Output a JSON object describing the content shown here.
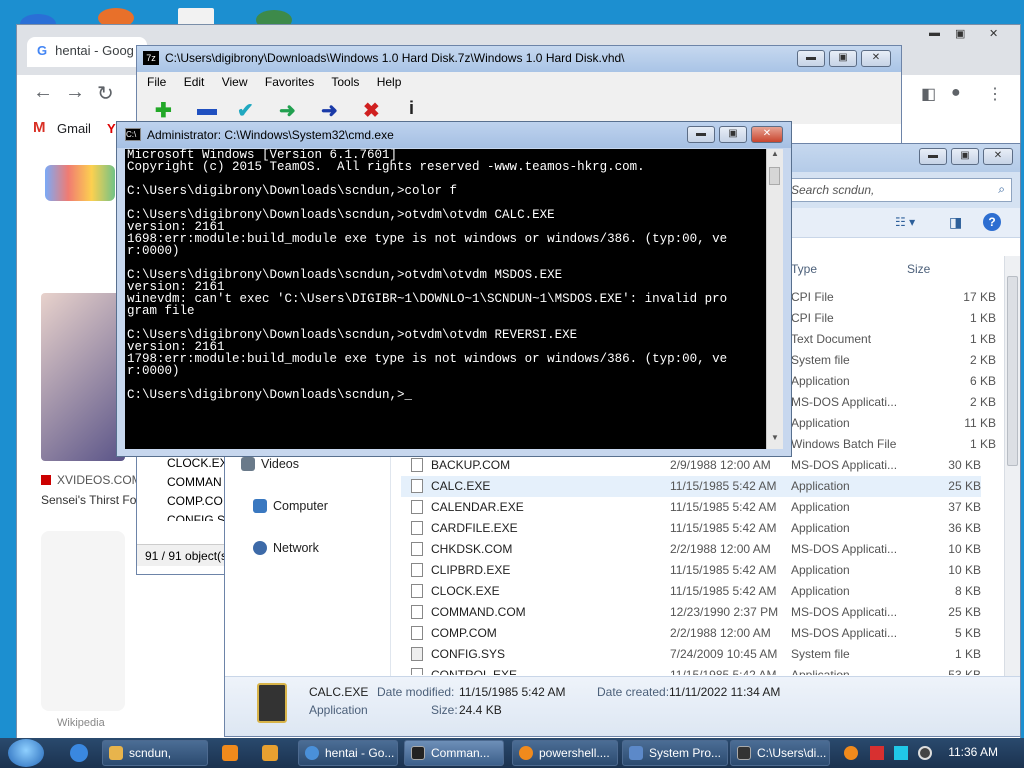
{
  "chrome": {
    "tab_title": "hentai - Goog",
    "bookmark_gmail": "Gmail",
    "bookmark_y": "Y",
    "sidebar_site": "XVIDEOS.COM",
    "sidebar_caption": "Sensei's Thirst Fo",
    "bottom_text": "Wikipedia"
  },
  "sevenzip": {
    "title": "C:\\Users\\digibrony\\Downloads\\Windows 1.0 Hard Disk.7z\\Windows 1.0 Hard Disk.vhd\\",
    "menu": [
      "File",
      "Edit",
      "View",
      "Favorites",
      "Tools",
      "Help"
    ],
    "files": [
      "CLOCK.EXE",
      "COMMAN",
      "COMP.CO",
      "CONFIG.S"
    ],
    "status": "91 / 91 object(s"
  },
  "explorer": {
    "search_placeholder": "Search scndun,",
    "col_type": "Type",
    "col_size": "Size",
    "nav": [
      "Videos",
      "Computer",
      "Network"
    ],
    "hidden_rows": [
      {
        "type": "CPI File",
        "size": "17 KB"
      },
      {
        "type": "CPI File",
        "size": "1 KB"
      },
      {
        "type": "Text Document",
        "size": "1 KB"
      },
      {
        "type": "System file",
        "size": "2 KB"
      },
      {
        "type": "Application",
        "size": "6 KB"
      },
      {
        "type": "MS-DOS Applicati...",
        "size": "2 KB"
      },
      {
        "type": "Application",
        "size": "11 KB"
      },
      {
        "type": "Windows Batch File",
        "size": "1 KB"
      }
    ],
    "rows": [
      {
        "name": "BACKUP.COM",
        "date": "2/9/1988 12:00 AM",
        "type": "MS-DOS Applicati...",
        "size": "30 KB"
      },
      {
        "name": "CALC.EXE",
        "date": "11/15/1985 5:42 AM",
        "type": "Application",
        "size": "25 KB"
      },
      {
        "name": "CALENDAR.EXE",
        "date": "11/15/1985 5:42 AM",
        "type": "Application",
        "size": "37 KB"
      },
      {
        "name": "CARDFILE.EXE",
        "date": "11/15/1985 5:42 AM",
        "type": "Application",
        "size": "36 KB"
      },
      {
        "name": "CHKDSK.COM",
        "date": "2/2/1988 12:00 AM",
        "type": "MS-DOS Applicati...",
        "size": "10 KB"
      },
      {
        "name": "CLIPBRD.EXE",
        "date": "11/15/1985 5:42 AM",
        "type": "Application",
        "size": "10 KB"
      },
      {
        "name": "CLOCK.EXE",
        "date": "11/15/1985 5:42 AM",
        "type": "Application",
        "size": "8 KB"
      },
      {
        "name": "COMMAND.COM",
        "date": "12/23/1990 2:37 PM",
        "type": "MS-DOS Applicati...",
        "size": "25 KB"
      },
      {
        "name": "COMP.COM",
        "date": "2/2/1988 12:00 AM",
        "type": "MS-DOS Applicati...",
        "size": "5 KB"
      },
      {
        "name": "CONFIG.SYS",
        "date": "7/24/2009 10:45 AM",
        "type": "System file",
        "size": "1 KB"
      },
      {
        "name": "CONTROL.EXE",
        "date": "11/15/1985 5:42 AM",
        "type": "Application",
        "size": "53 KB"
      }
    ],
    "details": {
      "name": "CALC.EXE",
      "kind": "Application",
      "modified_label": "Date modified:",
      "modified": "11/15/1985 5:42 AM",
      "created_label": "Date created:",
      "created": "11/11/2022 11:34 AM",
      "size_label": "Size:",
      "size": "24.4 KB"
    }
  },
  "cmd": {
    "title": "Administrator: C:\\Windows\\System32\\cmd.exe",
    "output": "Microsoft Windows [Version 6.1.7601]\nCopyright (c) 2015 TeamOS.  All rights reserved -www.teamos-hkrg.com.\n\nC:\\Users\\digibrony\\Downloads\\scndun,>color f\n\nC:\\Users\\digibrony\\Downloads\\scndun,>otvdm\\otvdm CALC.EXE\nversion: 2161\n1698:err:module:build_module exe type is not windows or windows/386. (typ:00, ve\nr:0000)\n\nC:\\Users\\digibrony\\Downloads\\scndun,>otvdm\\otvdm MSDOS.EXE\nversion: 2161\nwinevdm: can't exec 'C:\\Users\\DIGIBR~1\\DOWNLO~1\\SCNDUN~1\\MSDOS.EXE': invalid pro\ngram file\n\nC:\\Users\\digibrony\\Downloads\\scndun,>otvdm\\otvdm REVERSI.EXE\nversion: 2161\n1798:err:module:build_module exe type is not windows or windows/386. (typ:00, ve\nr:0000)\n\nC:\\Users\\digibrony\\Downloads\\scndun,>_"
  },
  "taskbar": {
    "buttons": [
      {
        "label": "scndun,",
        "color": "#e8b44c"
      },
      {
        "label": "hentai - Go...",
        "color": "#4a90d9"
      },
      {
        "label": "Comman...",
        "color": "#222222"
      },
      {
        "label": "powershell....",
        "color": "#f08a1c"
      },
      {
        "label": "System Pro...",
        "color": "#5c89c9"
      },
      {
        "label": "C:\\Users\\di...",
        "color": "#333333"
      }
    ],
    "time": "11:36 AM"
  },
  "colors": {
    "desktop": "#1c8fd0",
    "cmd_bg": "#000000",
    "selected_row": "#e5f0fb"
  }
}
